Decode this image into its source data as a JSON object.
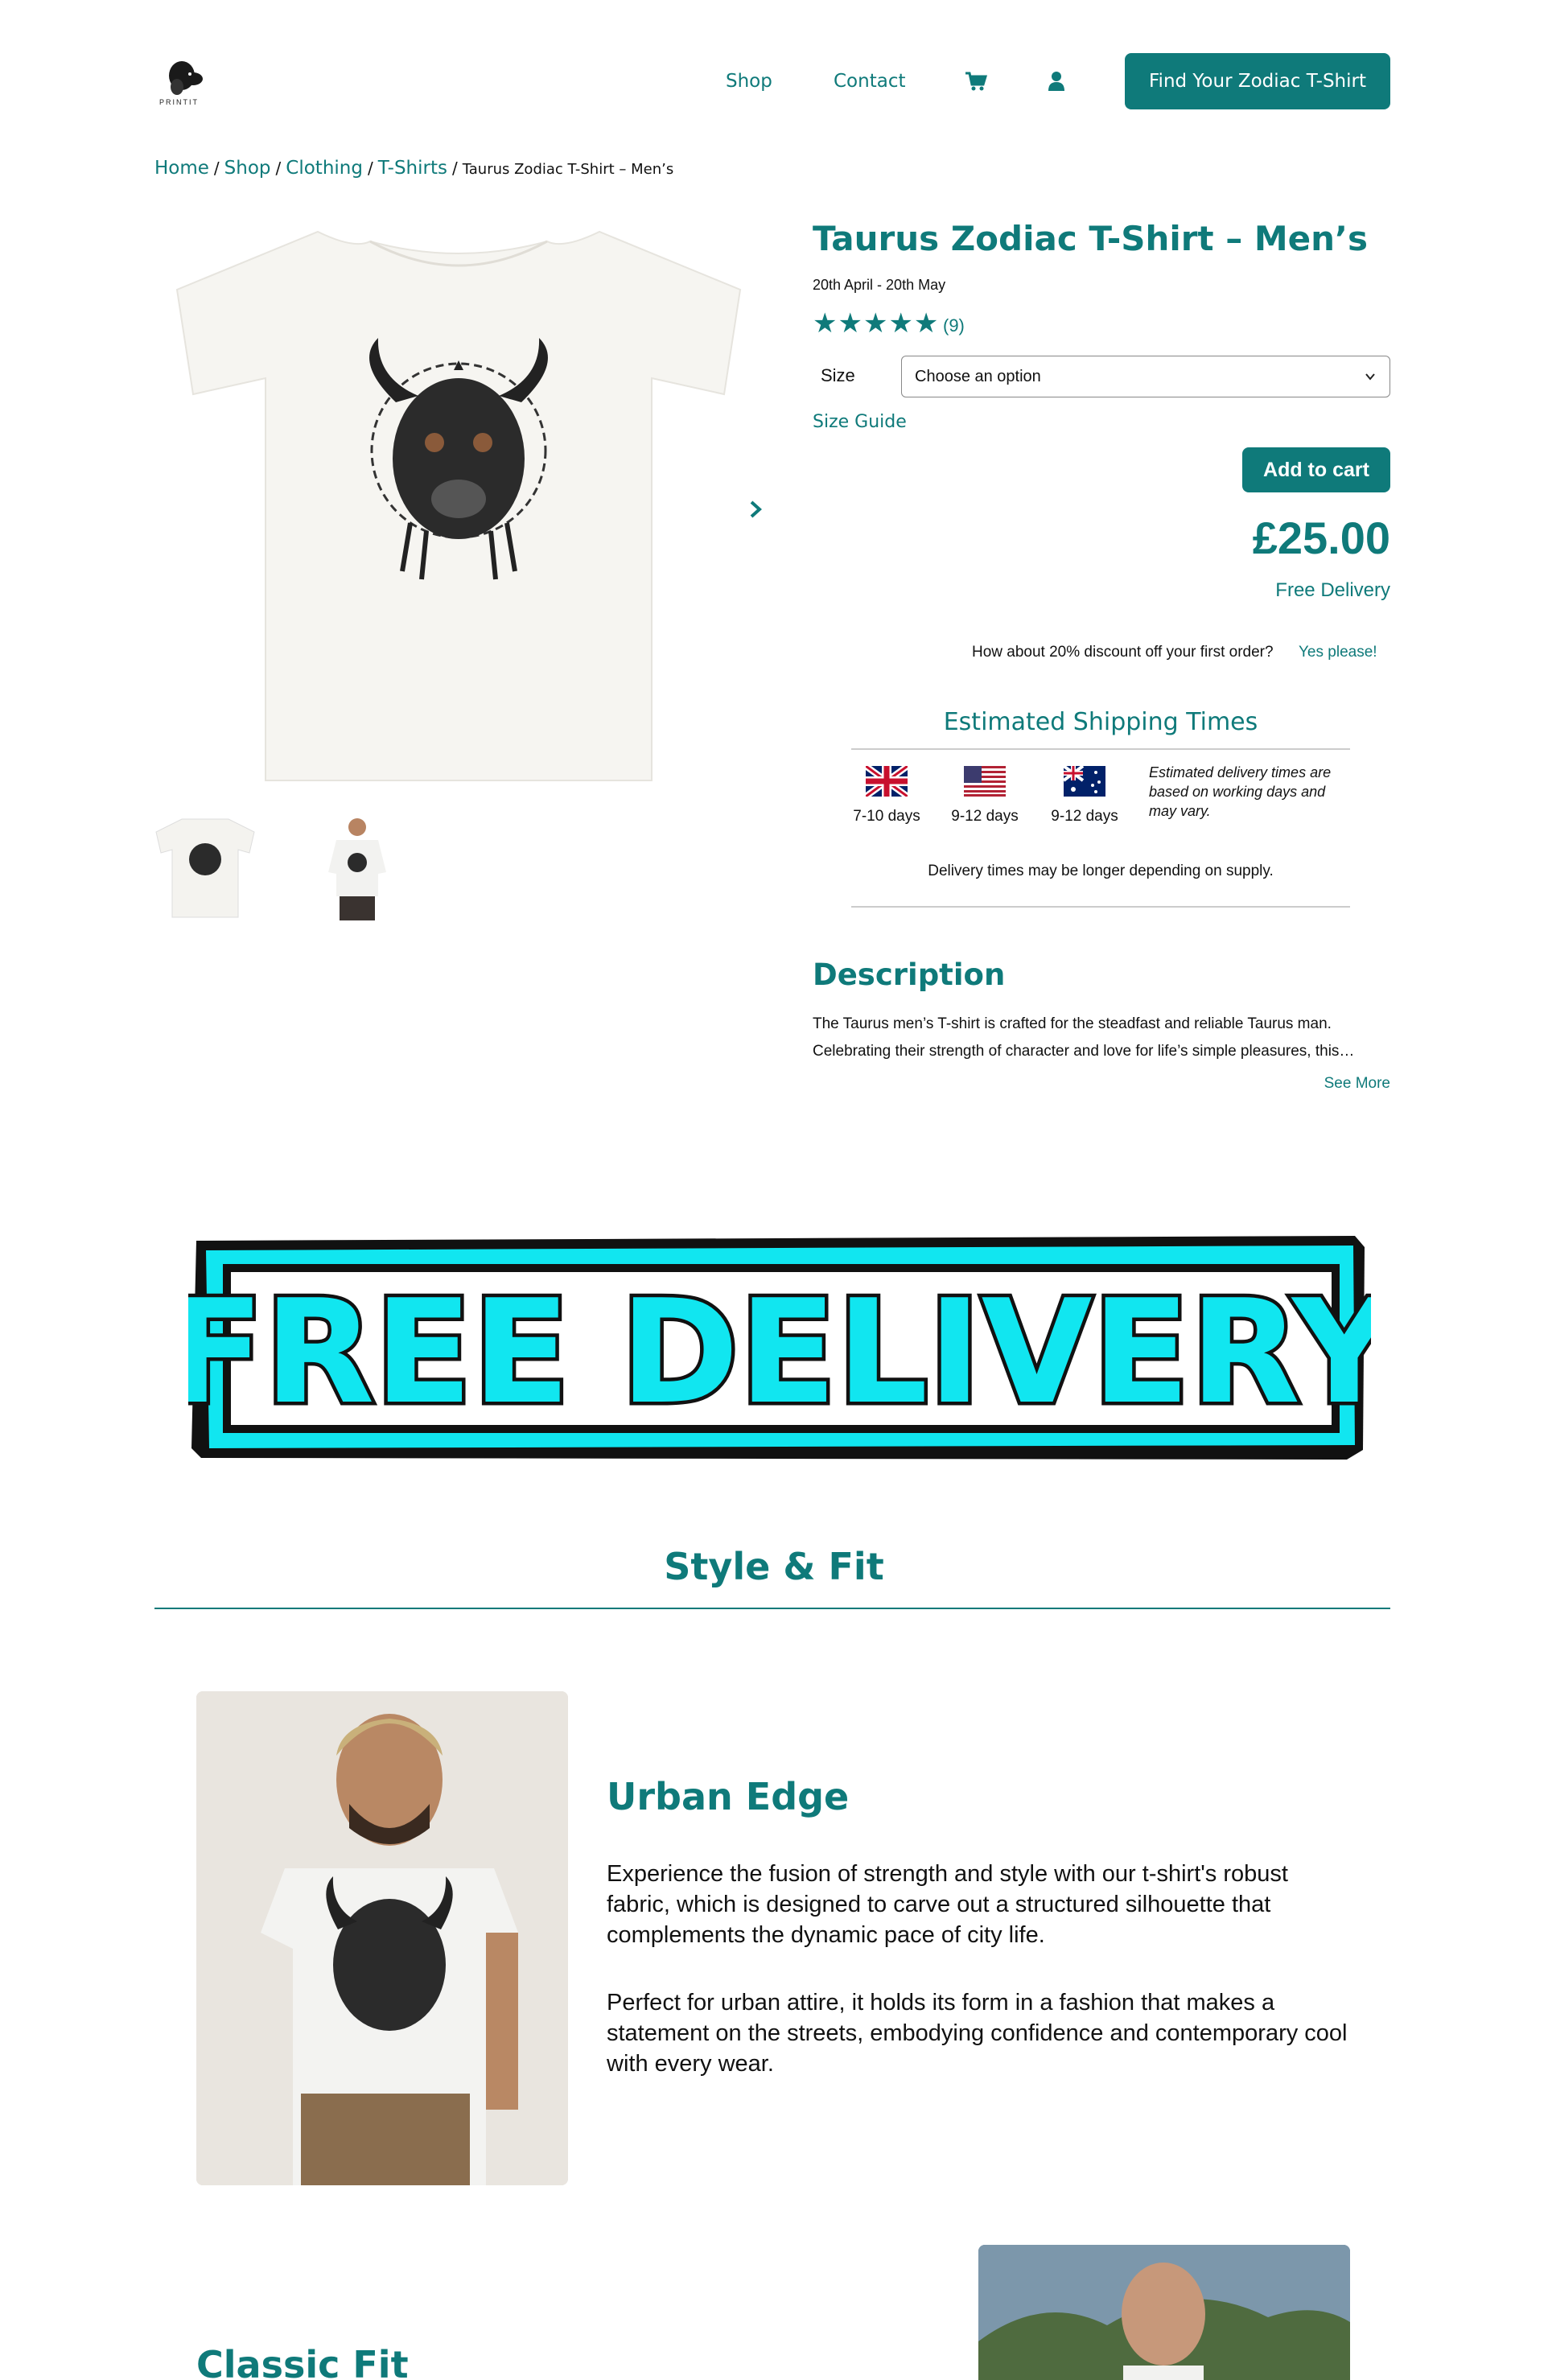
{
  "header": {
    "logo_text": "PRINTIT",
    "nav": {
      "shop": "Shop",
      "contact": "Contact"
    },
    "cart_icon": "cart-icon",
    "user_icon": "user-icon",
    "cta_label": "Find Your Zodiac T-Shirt"
  },
  "breadcrumb": {
    "home": "Home",
    "shop": "Shop",
    "clothing": "Clothing",
    "tshirts": "T-Shirts",
    "current": "Taurus Zodiac T-Shirt – Men’s"
  },
  "product": {
    "title": "Taurus Zodiac T-Shirt – Men’s",
    "dates": "20th April - 20th May",
    "stars": "★★★★★",
    "review_count": "(9)",
    "size_label": "Size",
    "size_placeholder": "Choose an option",
    "size_guide": "Size Guide",
    "add_to_cart": "Add to cart",
    "price": "£25.00",
    "free_delivery": "Free Delivery",
    "discount_text": "How about 20% discount off your first order?",
    "discount_link": "Yes please!"
  },
  "shipping": {
    "title": "Estimated Shipping Times",
    "uk_days": "7-10 days",
    "us_days": "9-12 days",
    "au_days": "9-12 days",
    "note": "Estimated delivery times are based on working days and may vary.",
    "supply_note": "Delivery times may be longer depending on supply."
  },
  "description": {
    "title": "Description",
    "line1": "The Taurus men’s T-shirt is crafted for the steadfast and reliable Taurus man.",
    "line2": "Celebrating their strength of character and love for life’s simple pleasures, this…",
    "see_more": "See More"
  },
  "banner": {
    "text": "FREE DELIVERY"
  },
  "style_fit": {
    "title": "Style & Fit",
    "urban_title": "Urban Edge",
    "urban_p1": "Experience the fusion of strength and style with our t-shirt's robust fabric, which is designed to carve out a structured silhouette that complements the dynamic pace of city life.",
    "urban_p2": "Perfect for urban attire, it holds its form in a fashion that makes a statement on the streets, embodying confidence and contemporary cool with every wear.",
    "classic_title": "Classic Fit"
  },
  "colors": {
    "accent": "#0f7a7a",
    "banner": "#11e6f0"
  }
}
